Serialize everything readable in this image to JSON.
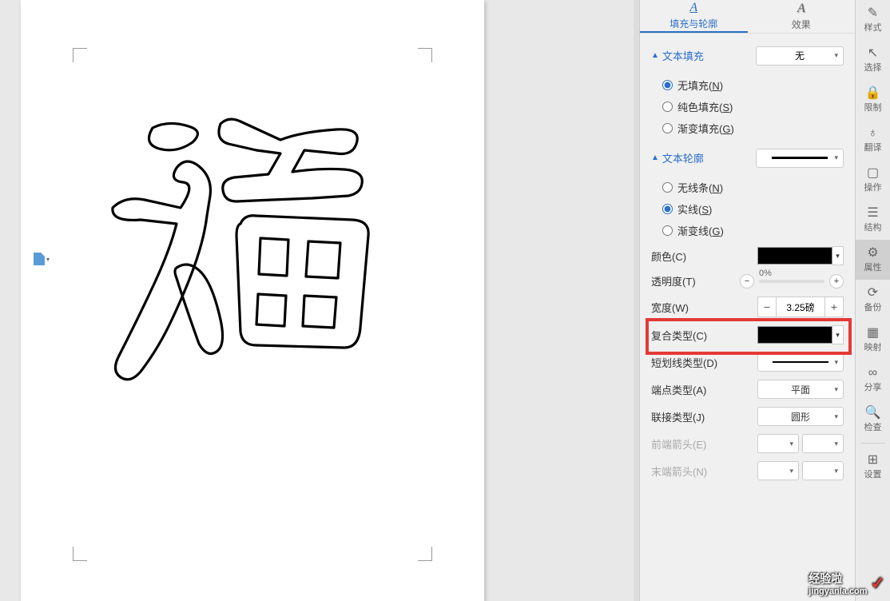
{
  "canvas": {
    "character": "福"
  },
  "panel": {
    "tabs": {
      "fill_outline": "填充与轮廓",
      "effect": "效果"
    },
    "text_fill": {
      "header": "文本填充",
      "none_option": "无",
      "radios": {
        "no_fill": "无填充",
        "no_fill_key": "N",
        "solid_fill": "纯色填充",
        "solid_fill_key": "S",
        "gradient_fill": "渐变填充",
        "gradient_fill_key": "G"
      }
    },
    "text_outline": {
      "header": "文本轮廓",
      "radios": {
        "no_line": "无线条",
        "no_line_key": "N",
        "solid_line": "实线",
        "solid_line_key": "S",
        "gradient_line": "渐变线",
        "gradient_line_key": "G"
      }
    },
    "props": {
      "color": "颜色",
      "color_key": "C",
      "transparency": "透明度",
      "transparency_key": "T",
      "transparency_value": "0%",
      "width": "宽度",
      "width_key": "W",
      "width_value": "3.25磅",
      "compound": "复合类型",
      "compound_key": "C",
      "dash": "短划线类型",
      "dash_key": "D",
      "cap": "端点类型",
      "cap_key": "A",
      "cap_value": "平面",
      "join": "联接类型",
      "join_key": "J",
      "join_value": "圆形",
      "arrow_front": "前端箭头",
      "arrow_front_key": "E",
      "arrow_end": "末端箭头",
      "arrow_end_key": "N"
    }
  },
  "toolbar": {
    "style": "样式",
    "select": "选择",
    "restrict": "限制",
    "translate": "翻译",
    "operate": "操作",
    "structure": "结构",
    "property": "属性",
    "backup": "备份",
    "mapping": "映射",
    "share": "分享",
    "check": "检查",
    "settings": "设置"
  },
  "watermark": {
    "brand": "经验啦",
    "site": "jingyanla.com"
  }
}
